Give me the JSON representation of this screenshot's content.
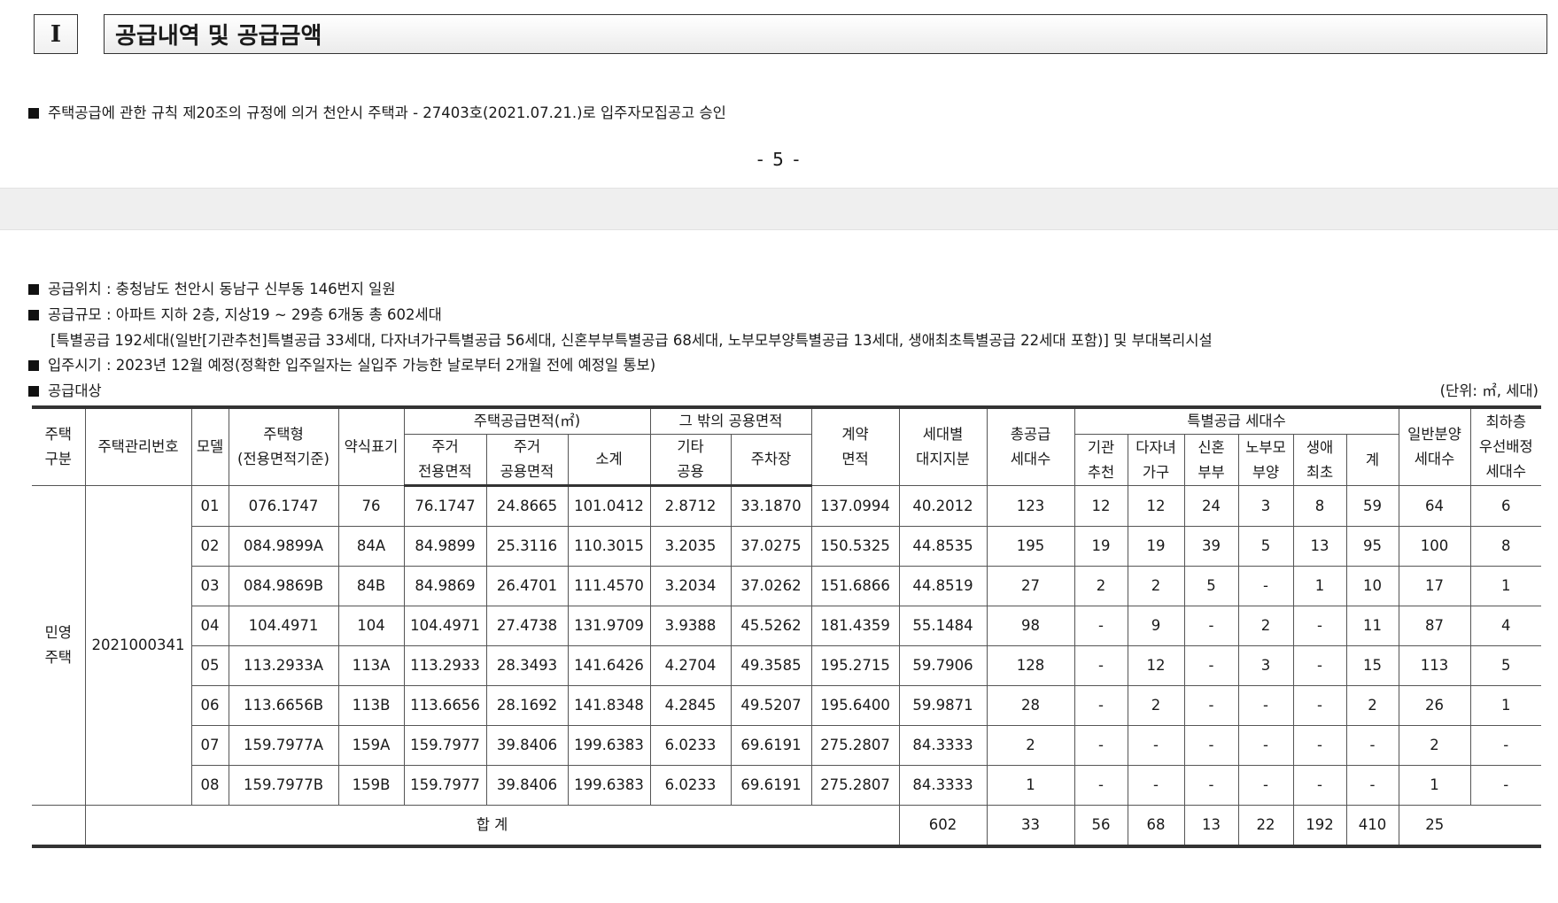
{
  "section": {
    "number": "I",
    "title": "공급내역 및 공급금액"
  },
  "approval_note": "주택공급에 관한 규칙 제20조의 규정에 의거 천안시 주택과 - 27403호(2021.07.21.)로 입주자모집공고 승인",
  "page_number": "- 5 -",
  "info": {
    "location": "공급위치 : 충청남도 천안시 동남구 신부동 146번지 일원",
    "scale": "공급규모 : 아파트 지하 2층, 지상19 ~ 29층  6개동 총 602세대",
    "scale_detail": "[특별공급 192세대(일반[기관추천]특별공급 33세대, 다자녀가구특별공급 56세대, 신혼부부특별공급 68세대, 노부모부양특별공급 13세대, 생애최초특별공급 22세대 포함)] 및 부대복리시설",
    "move_in": "입주시기 : 2023년 12월 예정(정확한 입주일자는 실입주 가능한 날로부터 2개월 전에 예정일 통보)",
    "target": "공급대상",
    "unit": "(단위: ㎡, 세대)"
  },
  "table": {
    "headers": {
      "housing_type": "주택\n구분",
      "mgmt_no": "주택관리번호",
      "model": "모델",
      "house_type": "주택형\n(전용면적기준)",
      "abbr": "약식표기",
      "supply_area": "주택공급면적(㎡)",
      "exclusive": "주거\n전용면적",
      "common": "주거\n공용면적",
      "subtotal": "소계",
      "other_common": "그 밖의 공용면적",
      "etc_common": "기타\n공용",
      "parking": "주차장",
      "contract_area": "계약\n면적",
      "land_share": "세대별\n대지지분",
      "total_units": "총공급\n세대수",
      "special": "특별공급 세대수",
      "institution": "기관\n추천",
      "multi_child": "다자녀\n가구",
      "newlywed": "신혼\n부부",
      "elderly": "노부모\n부양",
      "first_time": "생애\n최초",
      "special_sum": "계",
      "general": "일반분양\n세대수",
      "lowest_floor": "최하층\n우선배정\n세대수"
    },
    "category": "민영\n주택",
    "mgmt_number": "2021000341",
    "rows": [
      [
        "01",
        "076.1747",
        "76",
        "76.1747",
        "24.8665",
        "101.0412",
        "2.8712",
        "33.1870",
        "137.0994",
        "40.2012",
        "123",
        "12",
        "12",
        "24",
        "3",
        "8",
        "59",
        "64",
        "6"
      ],
      [
        "02",
        "084.9899A",
        "84A",
        "84.9899",
        "25.3116",
        "110.3015",
        "3.2035",
        "37.0275",
        "150.5325",
        "44.8535",
        "195",
        "19",
        "19",
        "39",
        "5",
        "13",
        "95",
        "100",
        "8"
      ],
      [
        "03",
        "084.9869B",
        "84B",
        "84.9869",
        "26.4701",
        "111.4570",
        "3.2034",
        "37.0262",
        "151.6866",
        "44.8519",
        "27",
        "2",
        "2",
        "5",
        "-",
        "1",
        "10",
        "17",
        "1"
      ],
      [
        "04",
        "104.4971",
        "104",
        "104.4971",
        "27.4738",
        "131.9709",
        "3.9388",
        "45.5262",
        "181.4359",
        "55.1484",
        "98",
        "-",
        "9",
        "-",
        "2",
        "-",
        "11",
        "87",
        "4"
      ],
      [
        "05",
        "113.2933A",
        "113A",
        "113.2933",
        "28.3493",
        "141.6426",
        "4.2704",
        "49.3585",
        "195.2715",
        "59.7906",
        "128",
        "-",
        "12",
        "-",
        "3",
        "-",
        "15",
        "113",
        "5"
      ],
      [
        "06",
        "113.6656B",
        "113B",
        "113.6656",
        "28.1692",
        "141.8348",
        "4.2845",
        "49.5207",
        "195.6400",
        "59.9871",
        "28",
        "-",
        "2",
        "-",
        "-",
        "-",
        "2",
        "26",
        "1"
      ],
      [
        "07",
        "159.7977A",
        "159A",
        "159.7977",
        "39.8406",
        "199.6383",
        "6.0233",
        "69.6191",
        "275.2807",
        "84.3333",
        "2",
        "-",
        "-",
        "-",
        "-",
        "-",
        "-",
        "2",
        "-"
      ],
      [
        "08",
        "159.7977B",
        "159B",
        "159.7977",
        "39.8406",
        "199.6383",
        "6.0233",
        "69.6191",
        "275.2807",
        "84.3333",
        "1",
        "-",
        "-",
        "-",
        "-",
        "-",
        "-",
        "1",
        "-"
      ]
    ],
    "total_label": "합  계",
    "totals": [
      "602",
      "33",
      "56",
      "68",
      "13",
      "22",
      "192",
      "410",
      "25"
    ]
  }
}
